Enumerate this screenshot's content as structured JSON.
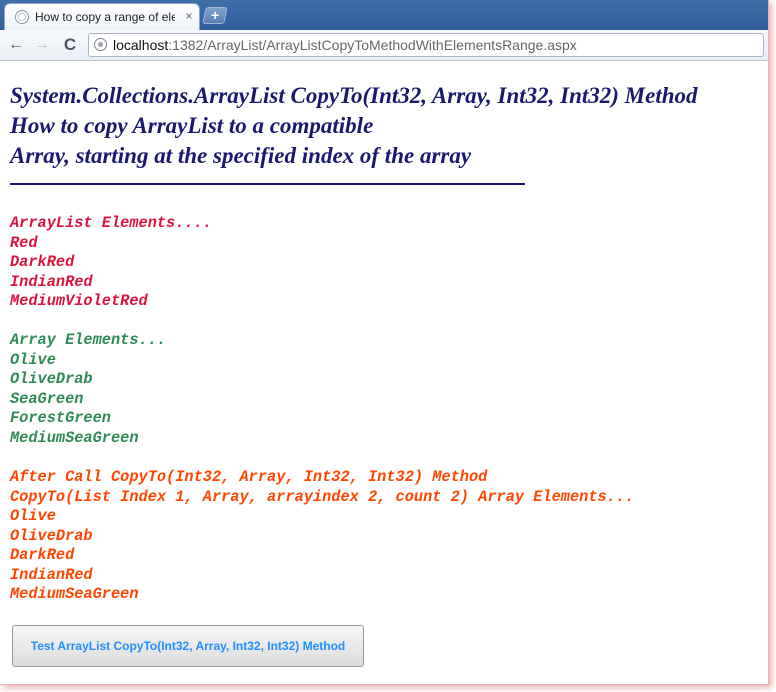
{
  "browser": {
    "tab_title": "How to copy a range of ele",
    "tab_close": "×",
    "new_tab": "+",
    "url_host": "localhost",
    "url_path": ":1382/ArrayList/ArrayListCopyToMethodWithElementsRange.aspx",
    "back": "←",
    "forward": "→",
    "reload": "C"
  },
  "page": {
    "heading_lines": [
      "System.Collections.ArrayList CopyTo(Int32, Array, Int32, Int32) Method",
      "How to copy ArrayList to a compatible",
      "Array, starting at the specified index of the array"
    ],
    "arraylist_section": {
      "header": "ArrayList Elements....",
      "items": [
        "Red",
        "DarkRed",
        "IndianRed",
        "MediumVioletRed"
      ]
    },
    "array_section": {
      "header": "Array Elements...",
      "items": [
        "Olive",
        "OliveDrab",
        "SeaGreen",
        "ForestGreen",
        "MediumSeaGreen"
      ]
    },
    "result_section": {
      "header1": "After Call CopyTo(Int32, Array, Int32, Int32) Method",
      "header2": "CopyTo(List Index 1, Array, arrayindex 2, count 2) Array Elements...",
      "items": [
        "Olive",
        "OliveDrab",
        "DarkRed",
        "IndianRed",
        "MediumSeaGreen"
      ]
    },
    "button_label": "Test ArrayList CopyTo(Int32, Array, Int32, Int32) Method"
  },
  "colors": {
    "heading": "#191970",
    "arraylist": "#dc143c",
    "array": "#2e8b57",
    "result": "#ff4500",
    "button_text": "#1e90ff"
  }
}
